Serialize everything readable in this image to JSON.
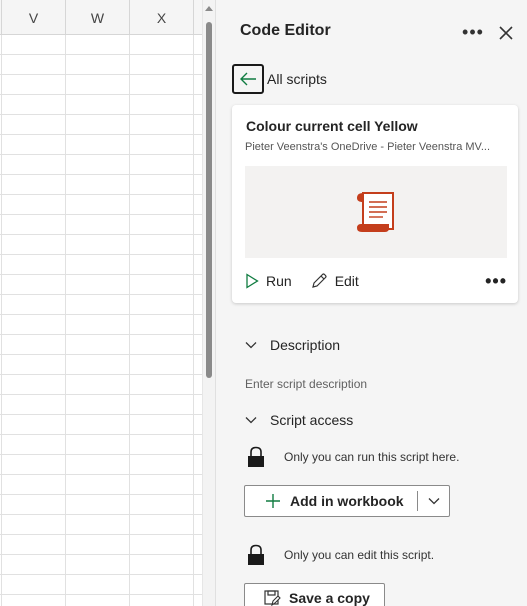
{
  "sheet": {
    "columns": [
      "V",
      "W",
      "X"
    ]
  },
  "pane": {
    "title": "Code Editor",
    "back_label": "All scripts",
    "card": {
      "title": "Colour current cell Yellow",
      "subtitle": "Pieter Veenstra's OneDrive - Pieter Veenstra MV...",
      "run_label": "Run",
      "edit_label": "Edit"
    },
    "description": {
      "heading": "Description",
      "placeholder": "Enter script description"
    },
    "access": {
      "heading": "Script access",
      "run_lock_text": "Only you can run this script here.",
      "add_label": "Add in workbook",
      "edit_lock_text": "Only you can edit this script.",
      "save_label": "Save a copy"
    }
  },
  "colors": {
    "pane_bg": "#f5f5f5",
    "accent_green": "#107c41",
    "script_icon": "#c43e1c"
  }
}
